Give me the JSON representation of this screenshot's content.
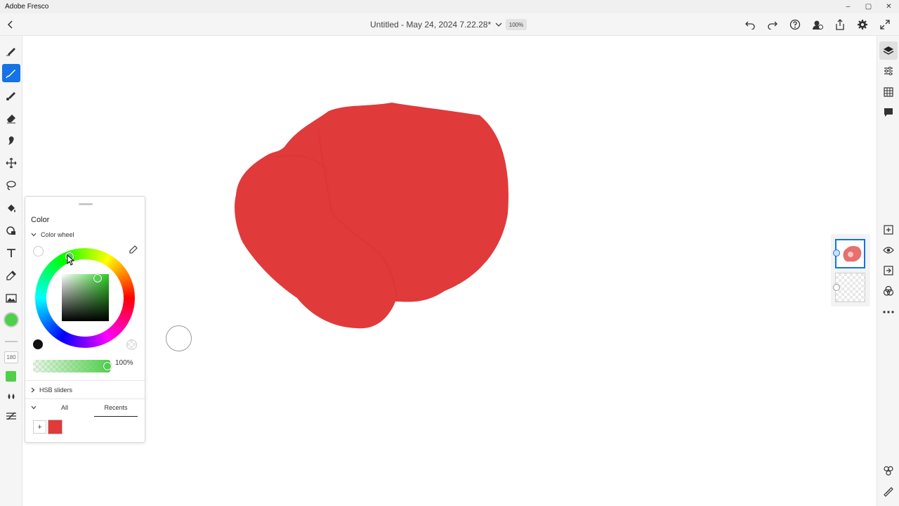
{
  "window": {
    "app_name": "Adobe Fresco",
    "controls": [
      "–",
      "▢",
      "✕"
    ]
  },
  "topbar": {
    "doc_title": "Untitled - May 24, 2024 7.22.28*",
    "zoom": "100%"
  },
  "left_toolbar": {
    "size_value": "180"
  },
  "color_panel": {
    "title": "Color",
    "color_wheel_label": "Color wheel",
    "opacity_label": "100%",
    "opacity_fraction": 1.0,
    "hsb_label": "HSB sliders",
    "tabs": {
      "all": "All",
      "recents": "Recents"
    },
    "add_label": "+",
    "current_color": "#4fcf4a",
    "recent_colors": [
      "#e03a3a"
    ]
  },
  "canvas": {
    "paint_color": "#e03a3a"
  },
  "colors": {
    "accent": "#1473e6",
    "paint": "#e03a3a",
    "brush_color": "#4fcf4a"
  }
}
